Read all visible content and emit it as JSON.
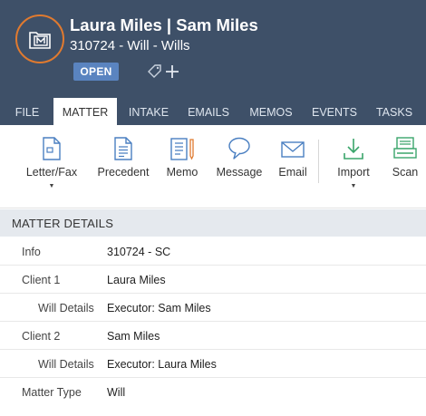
{
  "header": {
    "title": "Laura Miles | Sam Miles",
    "subtitle": "310724 - Will - Wills",
    "status": "OPEN",
    "avatar_icon": "matter-icon",
    "accent_color": "#e07a2f"
  },
  "tabs": [
    {
      "label": "FILE",
      "active": false
    },
    {
      "label": "MATTER",
      "active": true
    },
    {
      "label": "INTAKE",
      "active": false
    },
    {
      "label": "EMAILS",
      "active": false
    },
    {
      "label": "MEMOS",
      "active": false
    },
    {
      "label": "EVENTS",
      "active": false
    },
    {
      "label": "TASKS",
      "active": false
    }
  ],
  "ribbon": [
    {
      "label": "Letter/Fax",
      "icon": "letter-fax-icon",
      "dropdown": true
    },
    {
      "label": "Precedent",
      "icon": "precedent-icon",
      "dropdown": false
    },
    {
      "label": "Memo",
      "icon": "memo-icon",
      "dropdown": false
    },
    {
      "label": "Message",
      "icon": "message-icon",
      "dropdown": false
    },
    {
      "label": "Email",
      "icon": "email-icon",
      "dropdown": false
    },
    {
      "label": "Import",
      "icon": "import-icon",
      "dropdown": true
    },
    {
      "label": "Scan",
      "icon": "scan-icon",
      "dropdown": false
    }
  ],
  "section": {
    "title": "MATTER DETAILS"
  },
  "details": [
    {
      "label": "Info",
      "value": "310724 - SC"
    },
    {
      "label": "Client 1",
      "value": "Laura Miles"
    },
    {
      "label": "Will Details",
      "value": "Executor: Sam Miles"
    },
    {
      "label": "Client 2",
      "value": "Sam Miles"
    },
    {
      "label": "Will Details",
      "value": "Executor: Laura Miles"
    },
    {
      "label": "Matter Type",
      "value": "Will"
    }
  ]
}
